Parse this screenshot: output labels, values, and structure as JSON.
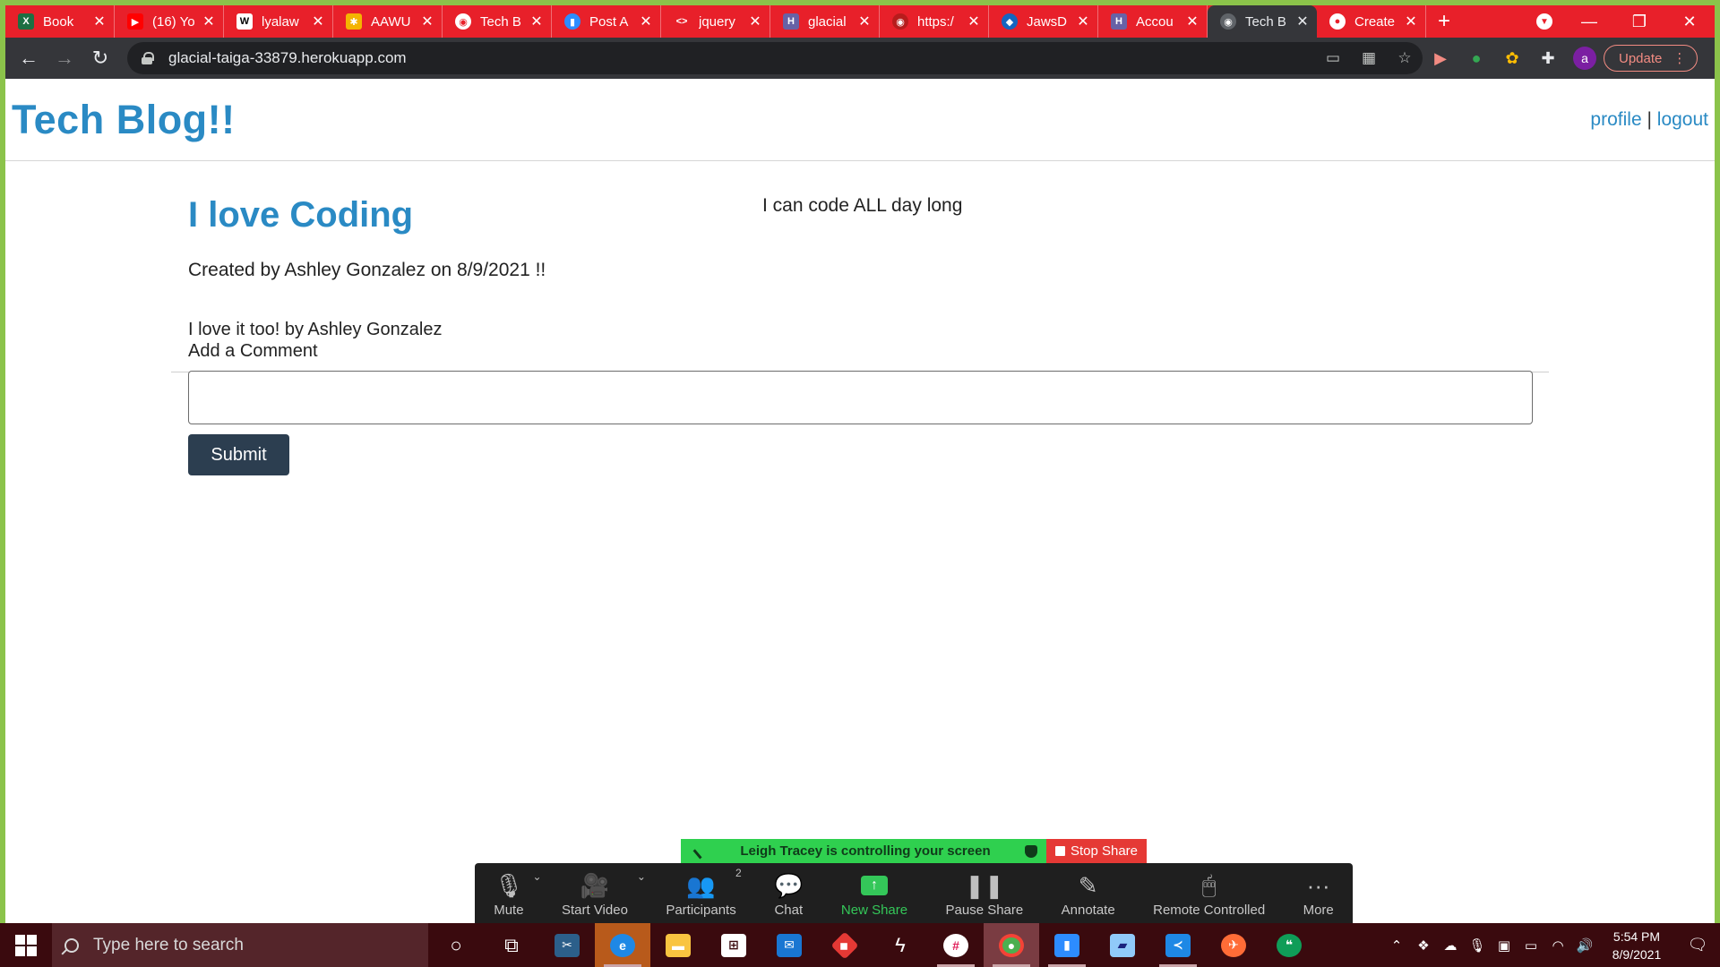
{
  "browser": {
    "tabs": [
      {
        "title": "Book",
        "favicon": "excel-icon",
        "color": "#1d6f42",
        "glyph": "X"
      },
      {
        "title": "(16) Yo",
        "favicon": "youtube-icon",
        "color": "#ff0000",
        "glyph": "▶"
      },
      {
        "title": "lyalaw",
        "favicon": "wikipedia-icon",
        "color": "#ffffff",
        "glyph": "W"
      },
      {
        "title": "AAWU",
        "favicon": "pinwheel-icon",
        "color": "#f4b400",
        "glyph": "✱"
      },
      {
        "title": "Tech B",
        "favicon": "globe-icon",
        "color": "#e8202a",
        "glyph": "◉"
      },
      {
        "title": "Post A",
        "favicon": "zoom-icon",
        "color": "#2d8cff",
        "glyph": "▮"
      },
      {
        "title": "jquery",
        "favicon": "code-icon",
        "color": "#e8202a",
        "glyph": "<>"
      },
      {
        "title": "glacial",
        "favicon": "heroku-icon",
        "color": "#6762a6",
        "glyph": "H"
      },
      {
        "title": "https:/",
        "favicon": "globe-icon",
        "color": "#b71c1c",
        "glyph": "◉"
      },
      {
        "title": "JawsD",
        "favicon": "jawsdb-icon",
        "color": "#1565c0",
        "glyph": "◆"
      },
      {
        "title": "Accou",
        "favicon": "heroku-icon",
        "color": "#6762a6",
        "glyph": "H"
      },
      {
        "title": "Tech B",
        "favicon": "globe-icon",
        "color": "#5f6368",
        "glyph": "◉",
        "active": true
      },
      {
        "title": "Create",
        "favicon": "github-icon",
        "color": "#e8202a",
        "glyph": "●"
      }
    ],
    "url": "glacial-taiga-33879.herokuapp.com",
    "update_label": "Update"
  },
  "site": {
    "title": "Tech Blog!!",
    "nav_profile": "profile",
    "nav_separator": "|",
    "nav_logout": "logout"
  },
  "post": {
    "title": "I love Coding",
    "meta": "Created by Ashley Gonzalez on 8/9/2021 !!",
    "body": "I can code ALL day long"
  },
  "comments": {
    "items": [
      "I love it too! by Ashley Gonzalez"
    ],
    "add_label": "Add a Comment",
    "input_value": "",
    "submit_label": "Submit"
  },
  "zoom": {
    "banner_text": "Leigh Tracey is controlling your screen",
    "stop_share": "Stop Share",
    "buttons": {
      "mute": "Mute",
      "start_video": "Start Video",
      "participants": "Participants",
      "participants_count": "2",
      "chat": "Chat",
      "new_share": "New Share",
      "pause_share": "Pause Share",
      "annotate": "Annotate",
      "remote_controlled": "Remote Controlled",
      "more": "More"
    }
  },
  "taskbar": {
    "search_placeholder": "Type here to search",
    "time": "5:54 PM",
    "date": "8/9/2021"
  }
}
